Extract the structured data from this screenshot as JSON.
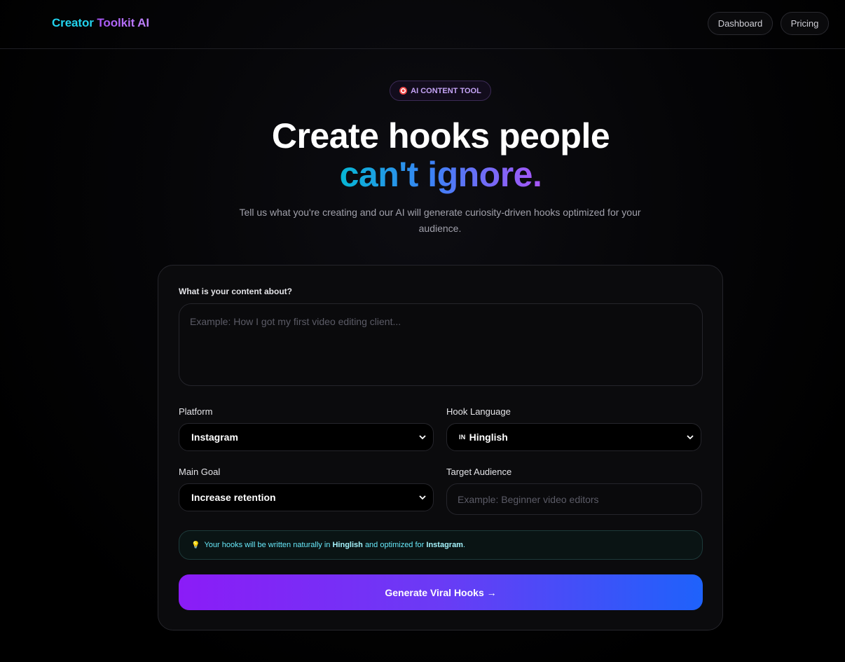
{
  "header": {
    "brand_part1": "Creator",
    "brand_part2": "Toolkit AI",
    "nav": {
      "dashboard": "Dashboard",
      "pricing": "Pricing"
    }
  },
  "hero": {
    "badge": "AI CONTENT TOOL",
    "title_line1": "Create hooks people",
    "title_line2": "can't ignore.",
    "subtitle": "Tell us what you're creating and our AI will generate curiosity-driven hooks optimized for your audience."
  },
  "form": {
    "content": {
      "label": "What is your content about?",
      "placeholder": "Example: How I got my first video editing client...",
      "value": ""
    },
    "platform": {
      "label": "Platform",
      "value": "Instagram"
    },
    "language": {
      "label": "Hook Language",
      "flag": "IN",
      "value": "Hinglish"
    },
    "goal": {
      "label": "Main Goal",
      "value": "Increase retention"
    },
    "audience": {
      "label": "Target Audience",
      "placeholder": "Example: Beginner video editors",
      "value": ""
    },
    "info": {
      "prefix": "Your hooks will be written naturally in",
      "language": "Hinglish",
      "middle": "and optimized for",
      "platform": "Instagram",
      "suffix": "."
    },
    "submit_label": "Generate Viral Hooks →"
  },
  "colors": {
    "accent_cyan": "#22d3ee",
    "accent_purple": "#a855f7",
    "button_start": "#8b1cf7",
    "button_end": "#1e62fb"
  }
}
